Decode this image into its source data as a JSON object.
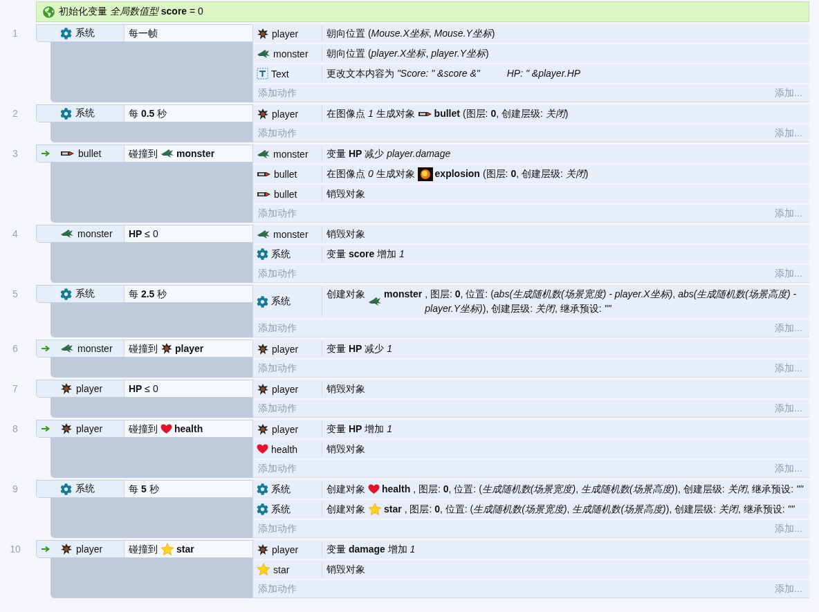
{
  "header": {
    "text": "初始化变量 *全局数值型* **score** = 0"
  },
  "events": [
    {
      "number": "1",
      "trigger": false,
      "condition": {
        "kind": "system",
        "object": "系统",
        "parts": [
          {
            "kind": "text",
            "text": "每一帧"
          }
        ]
      },
      "actions": [
        {
          "kind": "player",
          "object": "player",
          "parts": [
            {
              "kind": "text",
              "text": "朝向位置 (*Mouse.X坐标*, *Mouse.Y坐标*)"
            }
          ]
        },
        {
          "kind": "monster",
          "object": "monster",
          "parts": [
            {
              "kind": "text",
              "text": "朝向位置 (*player.X坐标*, *player.Y坐标*)"
            }
          ]
        },
        {
          "kind": "text",
          "object": "Text",
          "parts": [
            {
              "kind": "text",
              "text": "更改文本内容为 *\"Score: \" &score &\"          HP: \" &player.HP*"
            }
          ]
        }
      ],
      "add_action": "添加动作",
      "add_more": "添加..."
    },
    {
      "number": "2",
      "trigger": false,
      "condition": {
        "kind": "system",
        "object": "系统",
        "parts": [
          {
            "kind": "text",
            "text": "每 **0.5** 秒"
          }
        ]
      },
      "actions": [
        {
          "kind": "player",
          "object": "player",
          "parts": [
            {
              "kind": "text",
              "text": "在图像点 *1* 生成对象"
            },
            {
              "kind": "bullet",
              "name": "bullet"
            },
            {
              "kind": "text",
              "text": "(图层: **0**, 创建层级: *关闭*)"
            }
          ]
        }
      ],
      "add_action": "添加动作",
      "add_more": "添加..."
    },
    {
      "number": "3",
      "trigger": true,
      "condition": {
        "kind": "bullet",
        "object": "bullet",
        "parts": [
          {
            "kind": "text",
            "text": "碰撞到"
          },
          {
            "kind": "monster",
            "name": "monster"
          }
        ]
      },
      "actions": [
        {
          "kind": "monster",
          "object": "monster",
          "parts": [
            {
              "kind": "text",
              "text": "变量 **HP** 减少 *player.damage*"
            }
          ]
        },
        {
          "kind": "bullet",
          "object": "bullet",
          "parts": [
            {
              "kind": "text",
              "text": "在图像点 *0* 生成对象"
            },
            {
              "kind": "explosion",
              "name": "explosion"
            },
            {
              "kind": "text",
              "text": "(图层: **0**, 创建层级: *关闭*)"
            }
          ]
        },
        {
          "kind": "bullet",
          "object": "bullet",
          "parts": [
            {
              "kind": "text",
              "text": "销毁对象"
            }
          ]
        }
      ],
      "add_action": "添加动作",
      "add_more": "添加..."
    },
    {
      "number": "4",
      "trigger": false,
      "condition": {
        "kind": "monster",
        "object": "monster",
        "parts": [
          {
            "kind": "text",
            "text": "**HP** ≤ 0"
          }
        ]
      },
      "actions": [
        {
          "kind": "monster",
          "object": "monster",
          "parts": [
            {
              "kind": "text",
              "text": "销毁对象"
            }
          ]
        },
        {
          "kind": "system",
          "object": "系统",
          "parts": [
            {
              "kind": "text",
              "text": "变量 **score** 增加 *1*"
            }
          ]
        }
      ],
      "add_action": "添加动作",
      "add_more": "添加..."
    },
    {
      "number": "5",
      "trigger": false,
      "condition": {
        "kind": "system",
        "object": "系统",
        "parts": [
          {
            "kind": "text",
            "text": "每 **2.5** 秒"
          }
        ]
      },
      "actions": [
        {
          "kind": "system",
          "object": "系统",
          "parts": [
            {
              "kind": "text",
              "text": "创建对象"
            },
            {
              "kind": "monster",
              "name": "monster"
            },
            {
              "kind": "text",
              "text": ", 图层: **0**, 位置: (*abs(生成随机数(场景宽度) - player.X坐标)*, *abs(生成随机数(场景高度) - player.Y坐标)*), 创建层级: *关闭*, 继承预设: *\"\"*"
            }
          ]
        }
      ],
      "add_action": "添加动作",
      "add_more": "添加..."
    },
    {
      "number": "6",
      "trigger": true,
      "condition": {
        "kind": "monster",
        "object": "monster",
        "parts": [
          {
            "kind": "text",
            "text": "碰撞到"
          },
          {
            "kind": "player",
            "name": "player"
          }
        ]
      },
      "actions": [
        {
          "kind": "player",
          "object": "player",
          "parts": [
            {
              "kind": "text",
              "text": "变量 **HP** 减少 *1*"
            }
          ]
        }
      ],
      "add_action": "添加动作",
      "add_more": "添加..."
    },
    {
      "number": "7",
      "trigger": false,
      "condition": {
        "kind": "player",
        "object": "player",
        "parts": [
          {
            "kind": "text",
            "text": "**HP** ≤ 0"
          }
        ]
      },
      "actions": [
        {
          "kind": "player",
          "object": "player",
          "parts": [
            {
              "kind": "text",
              "text": "销毁对象"
            }
          ]
        }
      ],
      "add_action": "添加动作",
      "add_more": "添加..."
    },
    {
      "number": "8",
      "trigger": true,
      "condition": {
        "kind": "player",
        "object": "player",
        "parts": [
          {
            "kind": "text",
            "text": "碰撞到"
          },
          {
            "kind": "health",
            "name": "health"
          }
        ]
      },
      "actions": [
        {
          "kind": "player",
          "object": "player",
          "parts": [
            {
              "kind": "text",
              "text": "变量 **HP** 增加 *1*"
            }
          ]
        },
        {
          "kind": "health",
          "object": "health",
          "parts": [
            {
              "kind": "text",
              "text": "销毁对象"
            }
          ]
        }
      ],
      "add_action": "添加动作",
      "add_more": "添加..."
    },
    {
      "number": "9",
      "trigger": false,
      "condition": {
        "kind": "system",
        "object": "系统",
        "parts": [
          {
            "kind": "text",
            "text": "每 **5** 秒"
          }
        ]
      },
      "actions": [
        {
          "kind": "system",
          "object": "系统",
          "parts": [
            {
              "kind": "text",
              "text": "创建对象"
            },
            {
              "kind": "health",
              "name": "health"
            },
            {
              "kind": "text",
              "text": ", 图层: **0**, 位置: (*生成随机数(场景宽度)*, *生成随机数(场景高度)*), 创建层级: *关闭*, 继承预设: *\"\"*"
            }
          ]
        },
        {
          "kind": "system",
          "object": "系统",
          "parts": [
            {
              "kind": "text",
              "text": "创建对象"
            },
            {
              "kind": "star",
              "name": "star"
            },
            {
              "kind": "text",
              "text": ", 图层: **0**, 位置: (*生成随机数(场景宽度)*, *生成随机数(场景高度)*), 创建层级: *关闭*, 继承预设: *\"\"*"
            }
          ]
        }
      ],
      "add_action": "添加动作",
      "add_more": "添加..."
    },
    {
      "number": "10",
      "trigger": true,
      "condition": {
        "kind": "player",
        "object": "player",
        "parts": [
          {
            "kind": "text",
            "text": "碰撞到"
          },
          {
            "kind": "star",
            "name": "star"
          }
        ]
      },
      "actions": [
        {
          "kind": "player",
          "object": "player",
          "parts": [
            {
              "kind": "text",
              "text": "变量 **damage** 增加 *1*"
            }
          ]
        },
        {
          "kind": "star",
          "object": "star",
          "parts": [
            {
              "kind": "text",
              "text": "销毁对象"
            }
          ]
        }
      ],
      "add_action": "添加动作",
      "add_more": "添加..."
    }
  ]
}
